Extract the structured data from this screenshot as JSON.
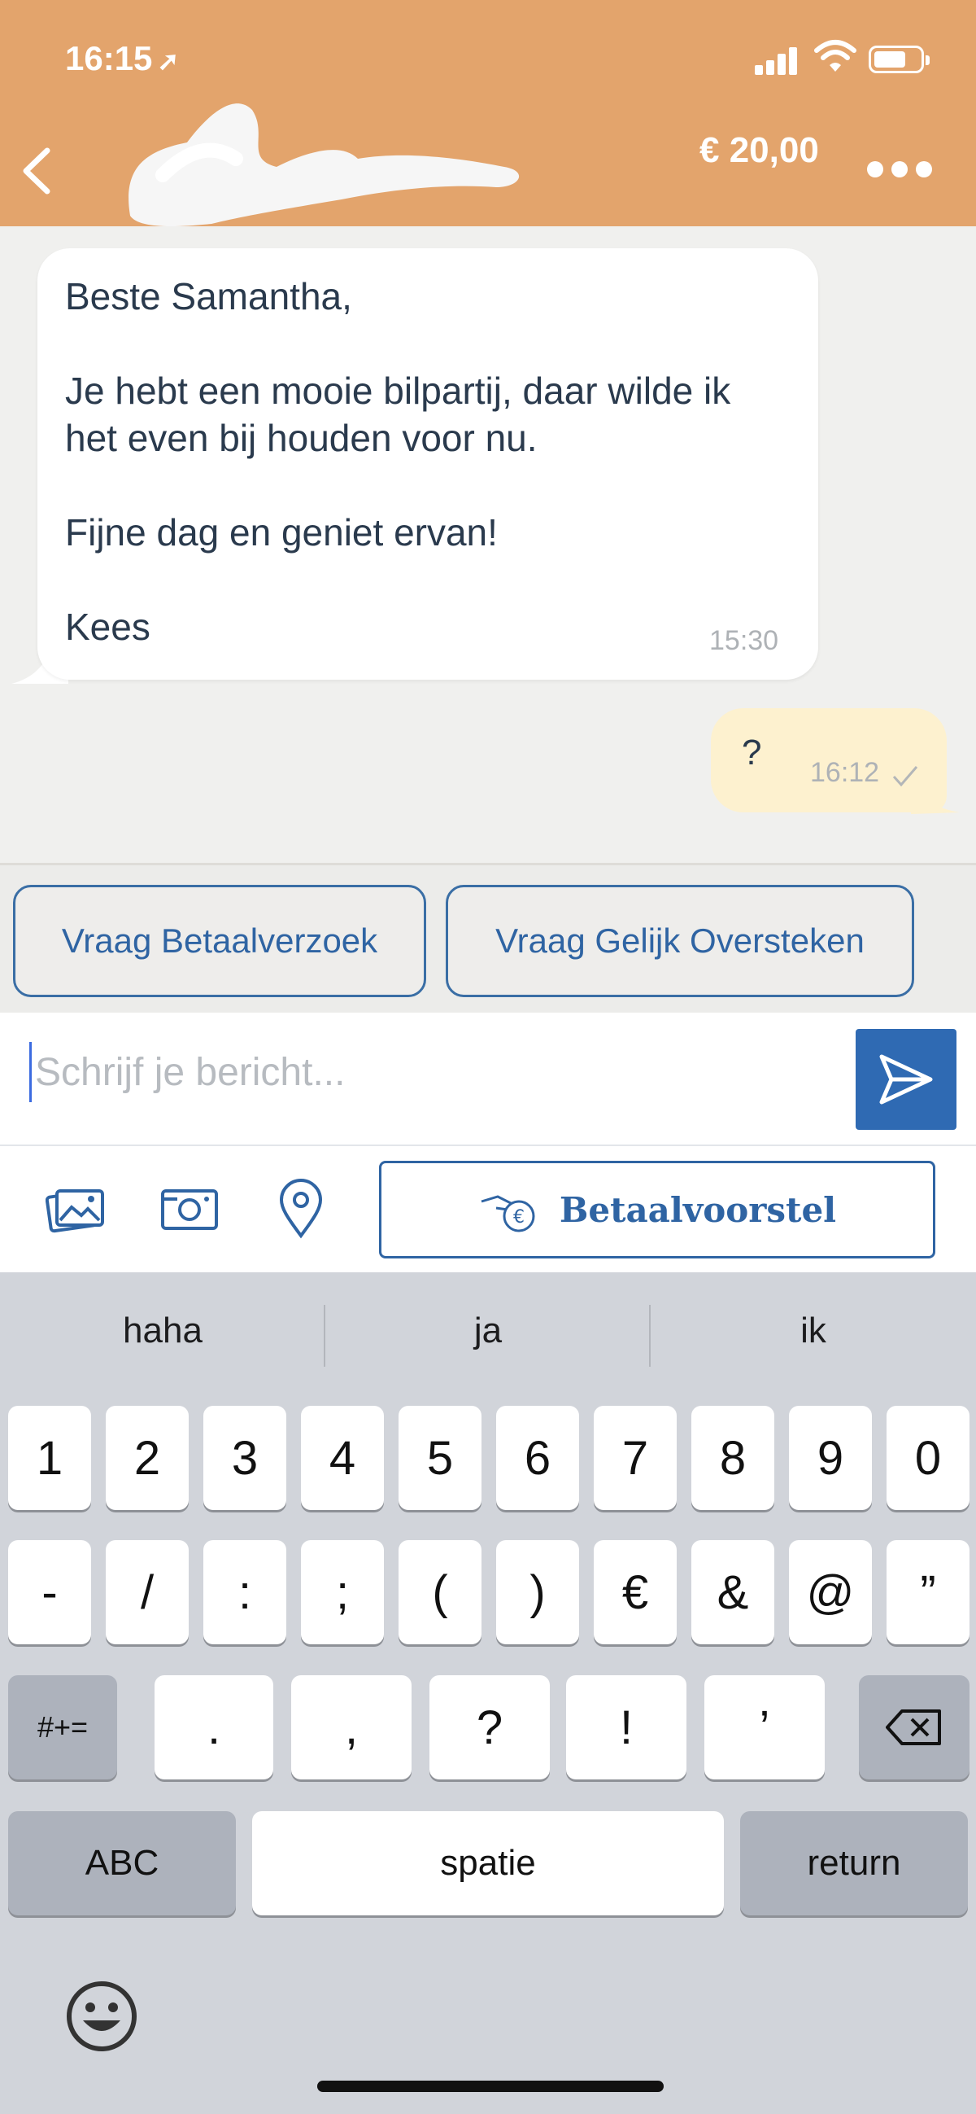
{
  "status_bar": {
    "time": "16:15",
    "location_arrow": "location-arrow-icon"
  },
  "header": {
    "price": "€ 20,00"
  },
  "messages": {
    "incoming": {
      "text": "Beste Samantha,\n\nJe hebt een mooie bilpartij, daar wilde ik het even bij houden voor nu.\n\nFijne dag en geniet ervan!\n\nKees",
      "time": "15:30"
    },
    "outgoing": {
      "text": "?",
      "time": "16:12"
    }
  },
  "quick_actions": {
    "betaalverzoek": "Vraag Betaalverzoek",
    "gelijk_oversteken": "Vraag Gelijk Oversteken"
  },
  "composer": {
    "placeholder": "Schrijf je bericht..."
  },
  "toolbar": {
    "betaalvoorstel": "Betaalvoorstel"
  },
  "keyboard": {
    "suggestions": [
      "haha",
      "ja",
      "ik"
    ],
    "row1": [
      "1",
      "2",
      "3",
      "4",
      "5",
      "6",
      "7",
      "8",
      "9",
      "0"
    ],
    "row2": [
      "-",
      "/",
      ":",
      ";",
      "(",
      ")",
      "€",
      "&",
      "@",
      "”"
    ],
    "row3": [
      "#+=",
      ".",
      ",",
      "?",
      "!",
      "’"
    ],
    "abc": "ABC",
    "space": "spatie",
    "return": "return"
  },
  "colors": {
    "header": "#e3a46c",
    "accent_blue": "#2f64a3",
    "outgoing_bubble": "#fdf1cf"
  }
}
